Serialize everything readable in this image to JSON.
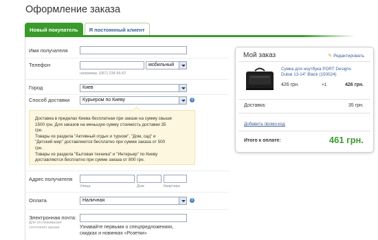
{
  "page": {
    "title": "Оформление заказа"
  },
  "tabs": [
    {
      "label": "Новый покупатель",
      "active": true
    },
    {
      "label": "Я постоянный клиент",
      "active": false
    }
  ],
  "form": {
    "recipient_name": {
      "label": "Имя получателя",
      "value": ""
    },
    "phone": {
      "label": "Телефон",
      "value": "",
      "type_selected": "мобильный",
      "hint": "например, (067) 234-56-67"
    },
    "city": {
      "label": "Город",
      "selected": "Киев"
    },
    "delivery_method": {
      "label": "Способ доставки",
      "selected": "Курьером по Киеву"
    },
    "delivery_info": [
      "Доставка в пределах Киева бесплатная при заказе на сумму свыше",
      "1500 грн. Для заказов на меньшую сумму стоимость доставки 35",
      "грн.",
      "Товары из раздела \"Активный отдых и туризм\", \"Дом, сад\" и",
      "\"Детский мир\" доставляются бесплатно при сумме заказа от 500",
      "грн.",
      "Товары из раздела \"Бытовая техника\" и \"Интерьер\" по Киеву",
      "доставляются бесплатно при сумме заказа от 800 грн."
    ],
    "address": {
      "label": "Адрес получателя",
      "street_hint": "Улица",
      "house_hint": "Дом",
      "apartment_hint": "Квартира"
    },
    "payment": {
      "label": "Оплата",
      "selected": "Наличная"
    },
    "email": {
      "label": "Электронная почта:",
      "sublabel_1": "Для отслеживания",
      "sublabel_2": "состояния заказа"
    },
    "subscribe_text": "Узнавайте первыми о спецпредложениях, скидках и новинках «Розетки»"
  },
  "order": {
    "title": "Мой заказ",
    "edit_label": "Редактировать",
    "product": {
      "name": "Сумка для ноутбука PORT Designs Dubai 13-14\" Black (150024)",
      "price": "426 грн.",
      "qty": "×1",
      "total": "426 грн."
    },
    "delivery_label": "Доставка:",
    "delivery_value": "35 грн.",
    "promo_label": "Добавить промо-код",
    "total_label": "Итого к оплате:",
    "total_value": "461 грн."
  },
  "colors": {
    "accent_green": "#3a9a2c",
    "link_blue": "#3a5d99",
    "info_bg": "#fcf7de"
  }
}
